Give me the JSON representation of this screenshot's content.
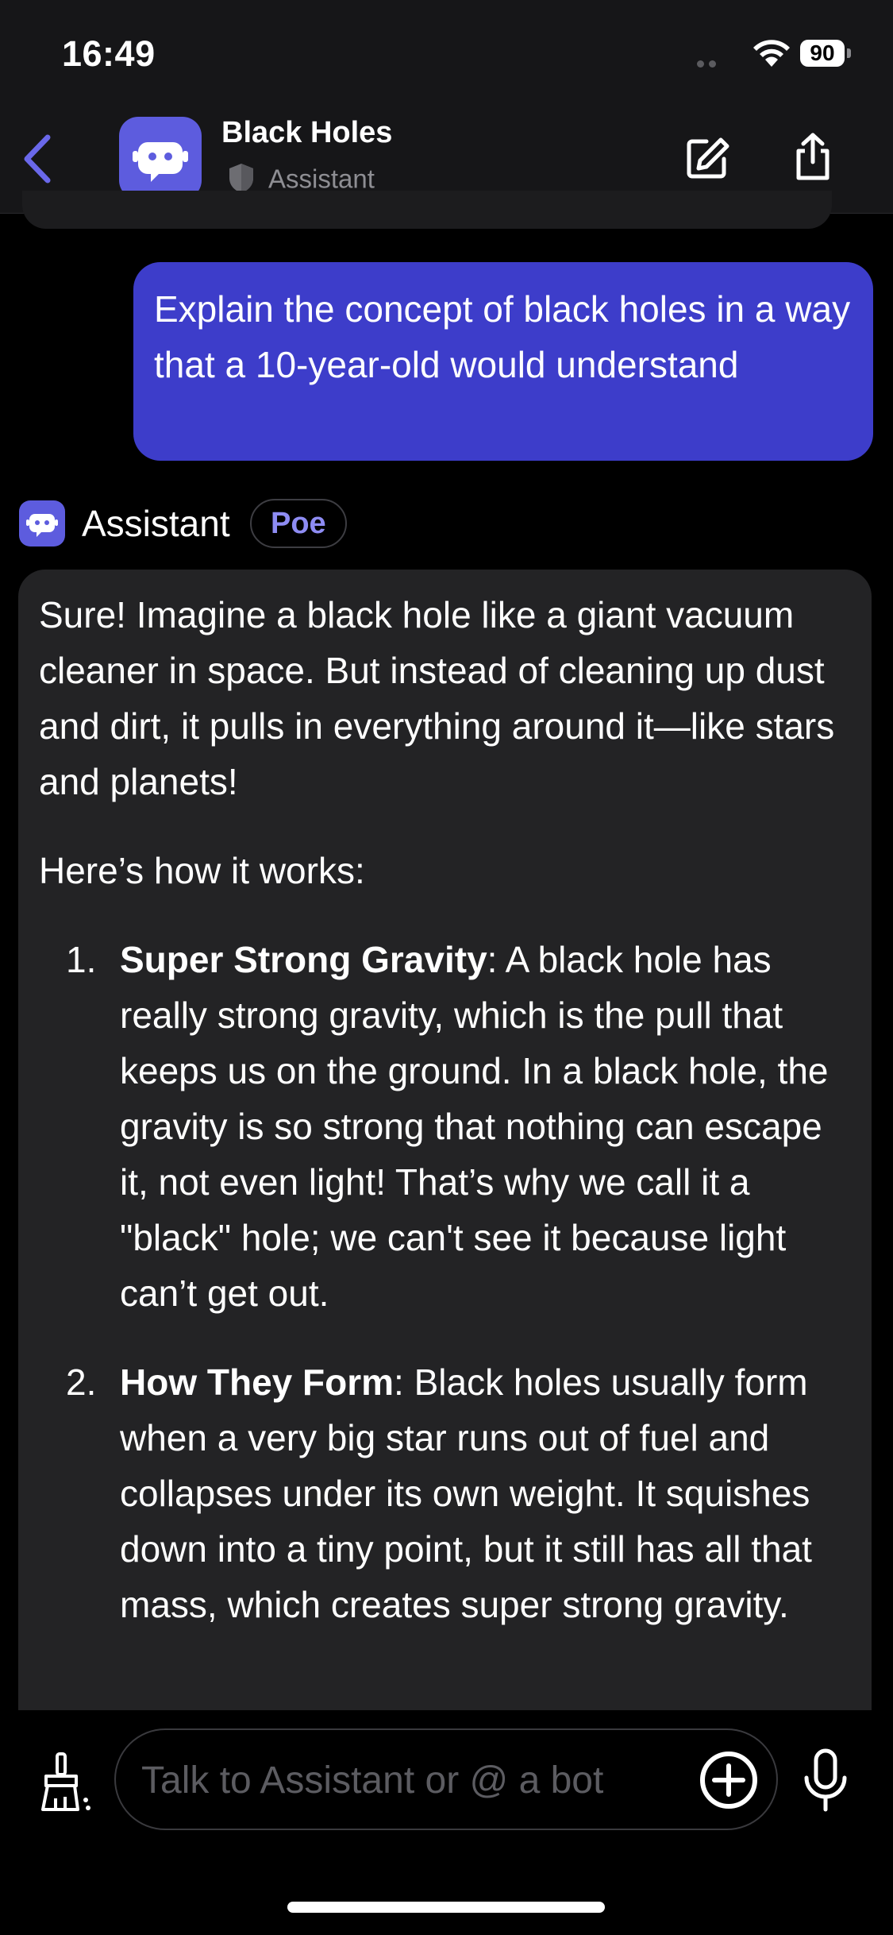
{
  "status_bar": {
    "time": "16:49",
    "battery": "90"
  },
  "header": {
    "title": "Black Holes",
    "subtitle": "Assistant"
  },
  "user_message": {
    "text": "Explain the concept of black holes in a way that a 10-year-old would understand"
  },
  "bot": {
    "name": "Assistant",
    "badge": "Poe"
  },
  "bot_message": {
    "intro": "Sure! Imagine a black hole like a giant vacuum cleaner in space. But instead of cleaning up dust and dirt, it pulls in everything around it—like stars and planets!",
    "lead": "Here’s how it works:",
    "items": [
      {
        "number": "1.",
        "heading": "Super Strong Gravity",
        "text": ": A black hole has really strong gravity, which is the pull that keeps us on the ground. In a black hole, the gravity is so strong that nothing can escape it, not even light! That’s why we call it a \"black\" hole; we can't see it because light can’t get out."
      },
      {
        "number": "2.",
        "heading": "How They Form",
        "text": ": Black holes usually form when a very big star runs out of fuel and collapses under its own weight. It squishes down into a tiny point, but it still has all that mass, which creates super strong gravity."
      }
    ]
  },
  "composer": {
    "placeholder": "Talk to Assistant or @ a bot"
  },
  "colors": {
    "accent": "#5d5cde",
    "user_bubble": "#3d3dca",
    "bot_bubble": "#232325",
    "badge_text": "#8e8cf3"
  }
}
